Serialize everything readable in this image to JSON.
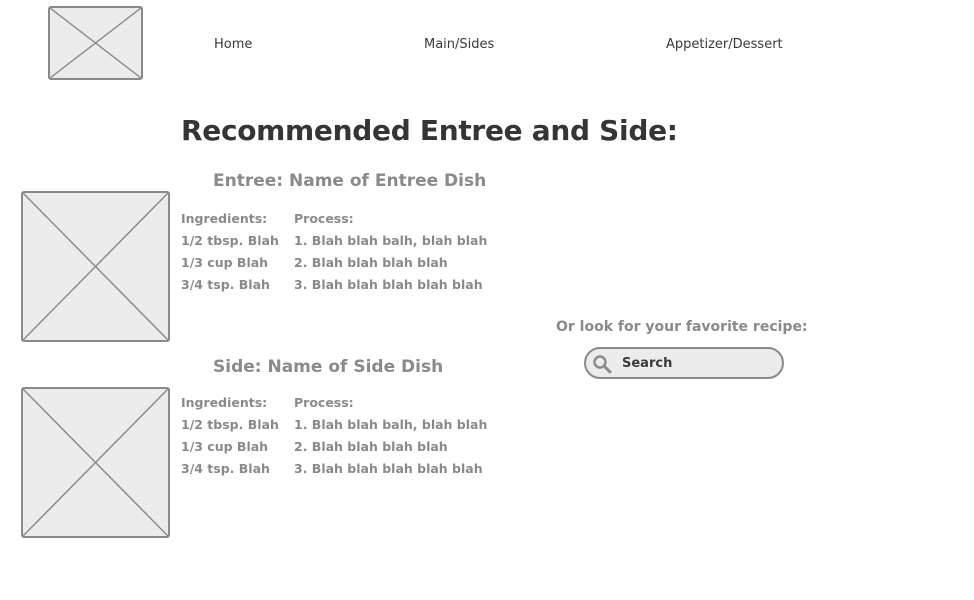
{
  "nav": {
    "logo": "logo-placeholder",
    "items": [
      {
        "label": "Home"
      },
      {
        "label": "Main/Sides"
      },
      {
        "label": "Appetizer/Dessert"
      }
    ]
  },
  "page": {
    "title": "Recommended Entree and Side:"
  },
  "entree": {
    "title": "Entree: Name of Entree Dish",
    "ingredients_header": "Ingredients:",
    "ingredients": [
      "1/2 tbsp. Blah",
      "1/3 cup Blah",
      "3/4 tsp. Blah"
    ],
    "process_header": "Process:",
    "process": [
      "1. Blah blah balh, blah blah",
      "2. Blah blah blah blah",
      "3. Blah blah blah blah blah"
    ]
  },
  "side": {
    "title": "Side: Name of Side Dish",
    "ingredients_header": "Ingredients:",
    "ingredients": [
      "1/2 tbsp. Blah",
      "1/3 cup Blah",
      "3/4 tsp. Blah"
    ],
    "process_header": "Process:",
    "process": [
      "1. Blah blah balh, blah blah",
      "2. Blah blah blah blah",
      "3. Blah blah blah blah blah"
    ]
  },
  "search": {
    "label": "Or look for your favorite recipe:",
    "placeholder": "Search",
    "icon": "search-icon"
  },
  "colors": {
    "placeholder_fill": "#ececec",
    "placeholder_stroke": "#8a8a8a",
    "heading": "#353535",
    "muted_text": "#8a8a8a"
  }
}
